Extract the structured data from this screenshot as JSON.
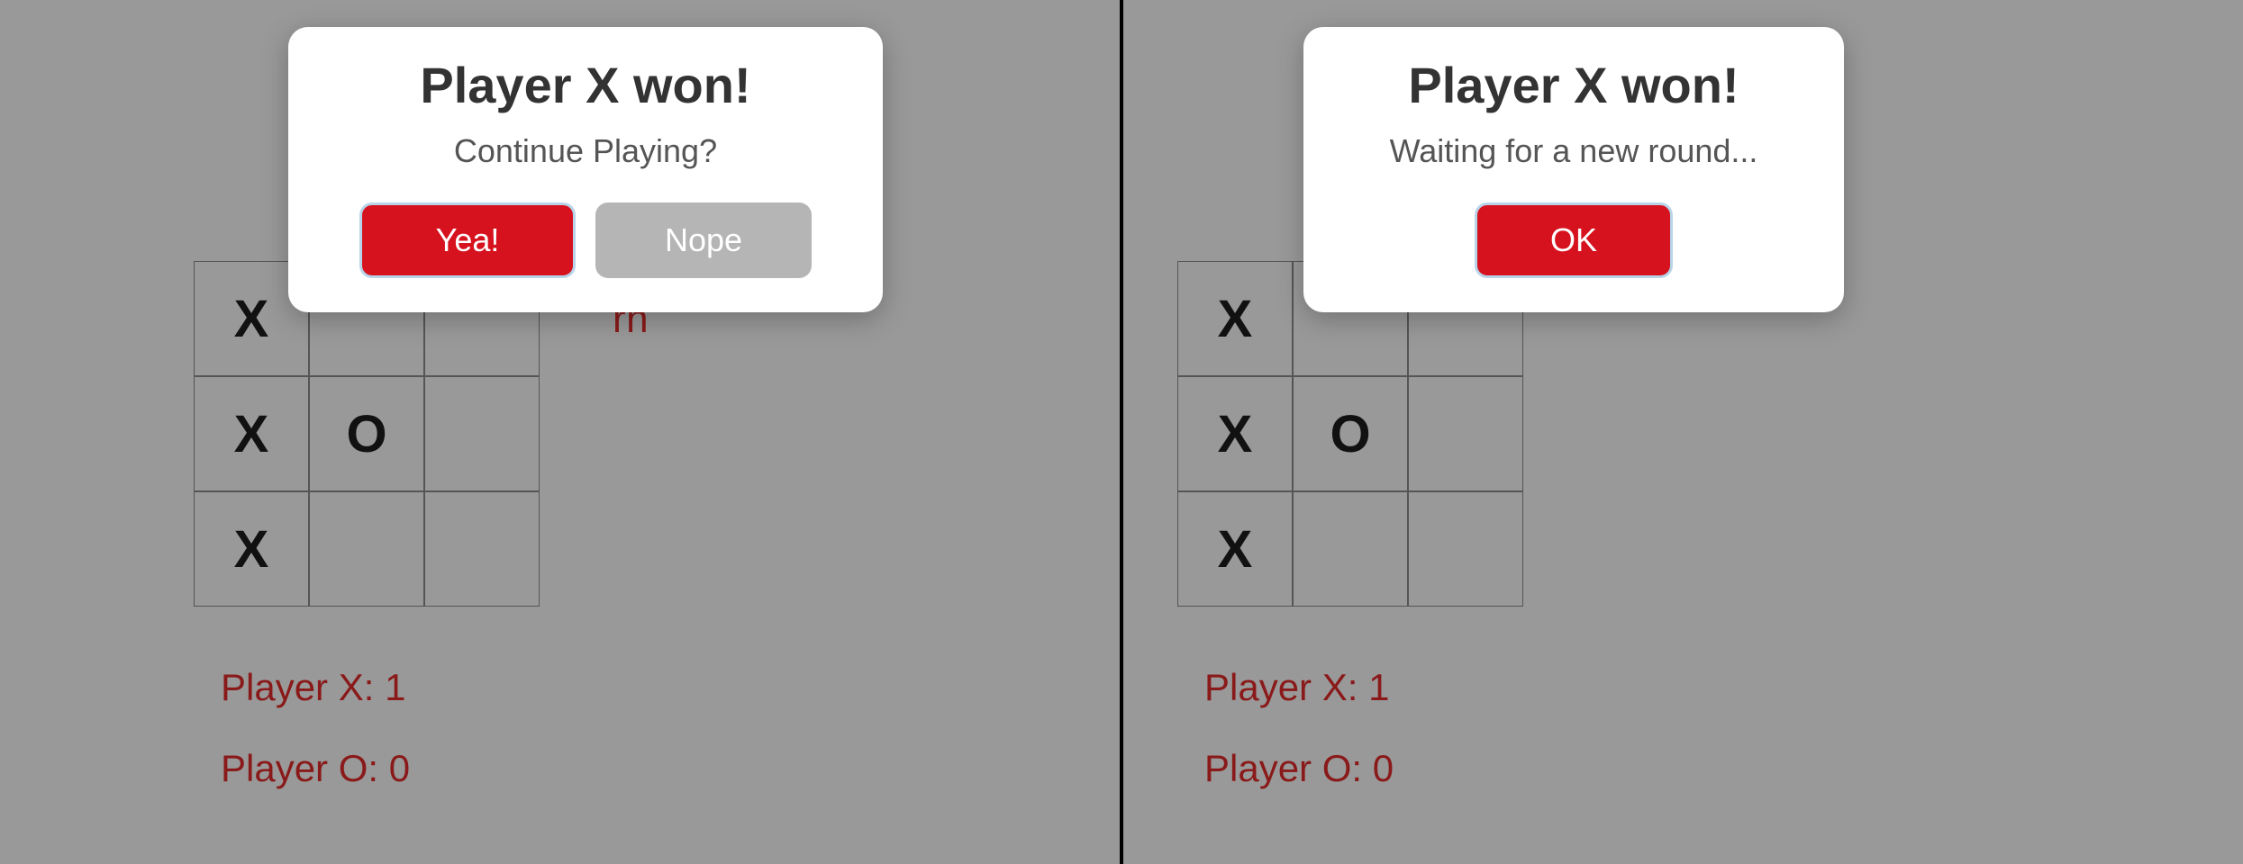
{
  "left": {
    "dialog": {
      "title": "Player X won!",
      "message": "Continue Playing?",
      "yes_label": "Yea!",
      "no_label": "Nope"
    },
    "turn_fragment": "rn",
    "board": [
      [
        "X",
        "",
        ""
      ],
      [
        "X",
        "O",
        ""
      ],
      [
        "X",
        "",
        ""
      ]
    ],
    "score_x": "Player X: 1",
    "score_o": "Player O: 0"
  },
  "right": {
    "dialog": {
      "title": "Player X won!",
      "message": "Waiting for a new round...",
      "ok_label": "OK"
    },
    "board": [
      [
        "X",
        "",
        ""
      ],
      [
        "X",
        "O",
        ""
      ],
      [
        "X",
        "",
        ""
      ]
    ],
    "score_x": "Player X: 1",
    "score_o": "Player O: 0"
  }
}
